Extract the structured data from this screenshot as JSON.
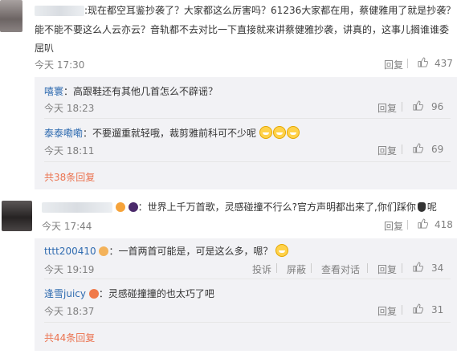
{
  "c1": {
    "text": ":现在都空耳鉴抄袭了？大家都这么厉害吗？61236大家都在用，蔡健雅用了就是抄袭？",
    "text2": "能不能不要这么人云亦云？音轨都不去对比一下直接就来讲蔡健雅抄袭，讲真的，这事儿搁谁谁委",
    "text3": "屈叭",
    "time": "今天 17:30",
    "reply": "回复",
    "likes": "437",
    "replies": [
      {
        "name": "嘻寰",
        "text": "：高跟鞋还有其他几首怎么不辟谣？",
        "time": "今天 18:23",
        "reply": "回复",
        "likes": "96"
      },
      {
        "name": "泰泰嘞嘞",
        "text": "：不要遛重就轻哦，裁剪雅前科可不少呢",
        "time": "今天 18:11",
        "reply": "回复",
        "likes": "69"
      }
    ],
    "more": "共38条回复"
  },
  "c2": {
    "text": "：世界上千万首歌，灵感碰撞不行么?官方声明都出来了,你们踩你",
    "text_tail": "呢",
    "time": "今天 17:44",
    "reply": "回复",
    "likes": "418",
    "replies": [
      {
        "name": "tttt200410",
        "text": "：一首两首可能是，可是这么多，嗯？",
        "time": "今天 19:19",
        "report": "投诉",
        "block": "屏蔽",
        "view": "查看对话",
        "reply": "回复",
        "likes": "34"
      },
      {
        "name": "逢雪juicy",
        "text": "：灵感碰撞撞的也太巧了吧",
        "time": "今天 18:37",
        "reply": "回复",
        "likes": "31"
      }
    ],
    "more": "共44条回复"
  },
  "colors": {
    "accent": "#eb7350",
    "link": "#2f6bb0",
    "panel": "#f2f2f5"
  }
}
